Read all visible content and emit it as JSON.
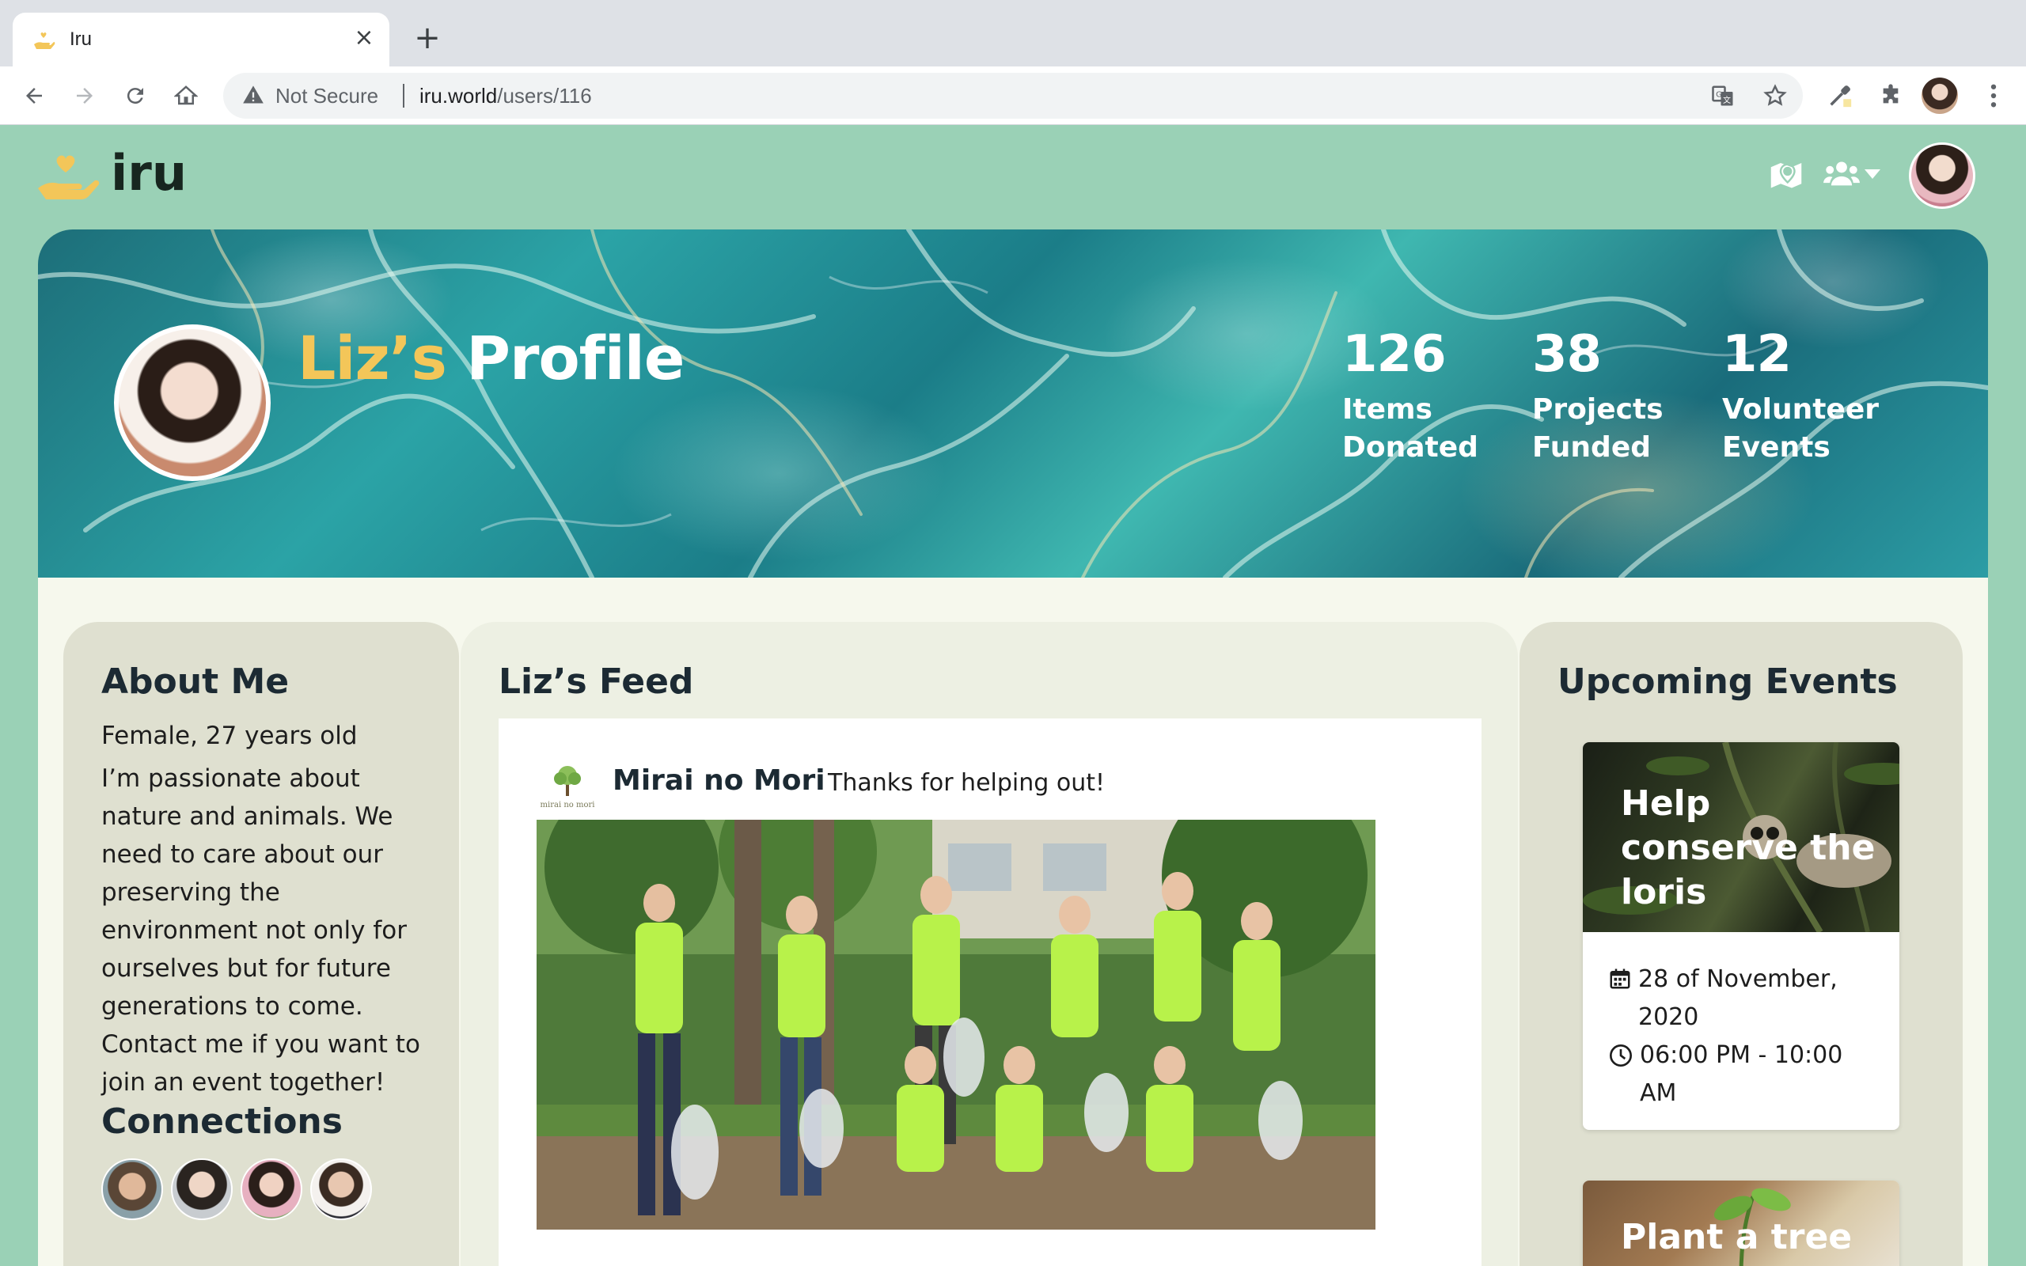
{
  "browser": {
    "tab_title": "Iru",
    "security_label": "Not Secure",
    "url_host": "iru.world",
    "url_path": "/users/116"
  },
  "site": {
    "logo_text": "iru",
    "brand_color": "#f3c659",
    "header_bg": "#9ad1b6"
  },
  "profile": {
    "name_possessive": "Liz’s",
    "title_suffix": " Profile",
    "stats": [
      {
        "value": "126",
        "label": "Items Donated"
      },
      {
        "value": "38",
        "label": "Projects Funded"
      },
      {
        "value": "12",
        "label": "Volunteer Events"
      }
    ]
  },
  "about": {
    "heading": "About Me",
    "demographics": "Female, 27 years old",
    "bio": "I’m passionate about nature and animals. We need to care about our preserving the environment not only for ourselves but for future generations to come. Contact me if you want to join an event together!",
    "connections_heading": "Connections",
    "connections": [
      "connection-avatar-1",
      "connection-avatar-2",
      "connection-avatar-3",
      "connection-avatar-4"
    ]
  },
  "feed": {
    "heading": "Liz’s Feed",
    "posts": [
      {
        "org": "Mirai no Mori",
        "message": "Thanks for helping out!",
        "logo_text": "mirai no mori"
      }
    ]
  },
  "events": {
    "heading": "Upcoming Events",
    "items": [
      {
        "title": "Help conserve the loris",
        "date": "28 of November, 2020",
        "time": "06:00 PM - 10:00 AM"
      },
      {
        "title": "Plant a tree"
      }
    ]
  }
}
